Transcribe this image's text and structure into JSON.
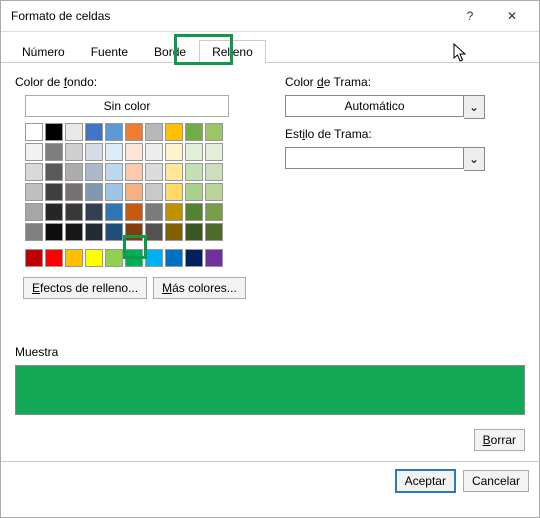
{
  "title": "Formato de celdas",
  "tabs": {
    "num": "Número",
    "fuente": "Fuente",
    "borde": "Borde",
    "relleno": "Relleno"
  },
  "labels": {
    "bgcolor_pre": "Color de ",
    "bgcolor_u": "f",
    "bgcolor_post": "ondo:",
    "nocolor": "Sin color",
    "patcolor_pre": "Color ",
    "patcolor_u": "d",
    "patcolor_post": "e Trama:",
    "patstyle_pre": "Est",
    "patstyle_u": "i",
    "patstyle_post": "lo de Trama:",
    "muestra": "Muestra"
  },
  "selects": {
    "pattern_color": "Automático",
    "pattern_style": ""
  },
  "buttons": {
    "effects_pre": "",
    "effects_u": "E",
    "effects_post": "fectos de relleno...",
    "more_pre": "",
    "more_u": "M",
    "more_post": "ás colores...",
    "clear_pre": "",
    "clear_u": "B",
    "clear_post": "orrar",
    "accept": "Aceptar",
    "cancel": "Cancelar"
  },
  "icons": {
    "help": "?",
    "close": "✕",
    "chevron": "⌄"
  },
  "palette_theme": [
    [
      "#ffffff",
      "#000000",
      "#e8e8e8",
      "#4472c4",
      "#5b9bd5",
      "#ed7d31",
      "#b8b8b8",
      "#ffc000",
      "#70ad47",
      "#9dc66b"
    ],
    [
      "#f2f2f2",
      "#7f7f7f",
      "#d0cece",
      "#d6dce5",
      "#deebf7",
      "#fbe5d6",
      "#ededed",
      "#fff2cc",
      "#e2f0d9",
      "#e3efda"
    ],
    [
      "#d9d9d9",
      "#595959",
      "#aeabab",
      "#adb9ca",
      "#bdd7ee",
      "#f8cbad",
      "#dbdbdb",
      "#ffe699",
      "#c5e0b4",
      "#cee0bb"
    ],
    [
      "#bfbfbf",
      "#404040",
      "#757171",
      "#8497b0",
      "#9dc3e6",
      "#f4b183",
      "#c9c9c9",
      "#ffd966",
      "#a9d18e",
      "#b9d597"
    ],
    [
      "#a6a6a6",
      "#262626",
      "#3a3838",
      "#333f50",
      "#2f75b6",
      "#c55a11",
      "#7b7b7b",
      "#bf9000",
      "#548235",
      "#7a9d4a"
    ],
    [
      "#808080",
      "#0d0d0d",
      "#171717",
      "#222a35",
      "#1f4e79",
      "#843c0c",
      "#525252",
      "#806000",
      "#385723",
      "#4f6b2a"
    ]
  ],
  "palette_standard": [
    "#c00000",
    "#ff0000",
    "#ffc000",
    "#ffff00",
    "#92d050",
    "#00b050",
    "#00b0f0",
    "#0070c0",
    "#002060",
    "#7030a0"
  ],
  "sample_color": "#13a855"
}
